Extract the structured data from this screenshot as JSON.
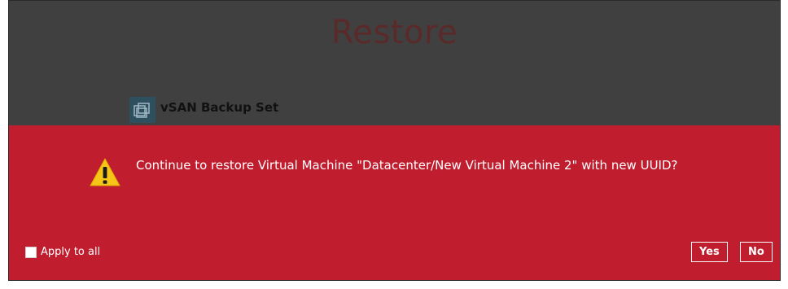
{
  "window": {
    "title": "Restore"
  },
  "backup_set": {
    "name": "vSAN Backup Set",
    "icon": "vm-icon"
  },
  "dialog": {
    "icon": "warning-icon",
    "message": "Continue to restore Virtual Machine \"Datacenter/New Virtual Machine 2\" with new UUID?",
    "checkbox_label": "Apply to all",
    "checkbox_checked": false,
    "yes_label": "Yes",
    "no_label": "No",
    "background_color": "#c01d2e"
  }
}
